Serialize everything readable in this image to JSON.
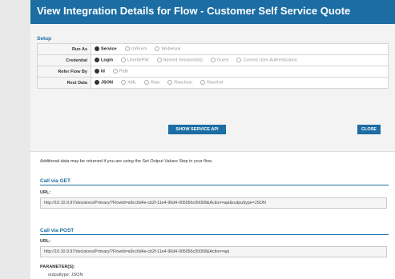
{
  "dialog": {
    "title": "View Integration Details for Flow - Customer Self Service Quote"
  },
  "setup": {
    "section_label": "Setup",
    "rows": [
      {
        "label": "Run As",
        "options": [
          {
            "text": "Service",
            "selected": true
          },
          {
            "text": "UI/Form",
            "selected": false
          },
          {
            "text": "WebHook",
            "selected": false
          }
        ]
      },
      {
        "label": "Credential",
        "options": [
          {
            "text": "Login",
            "selected": true
          },
          {
            "text": "UserId/PW",
            "selected": false
          },
          {
            "text": "Named Session(list)",
            "selected": false
          },
          {
            "text": "Guest",
            "selected": false
          },
          {
            "text": "Current User Authentication",
            "selected": false
          }
        ]
      },
      {
        "label": "Refer Flow By",
        "options": [
          {
            "text": "Id",
            "selected": true
          },
          {
            "text": "Path",
            "selected": false
          }
        ]
      },
      {
        "label": "Rest Data",
        "options": [
          {
            "text": "JSON",
            "selected": true
          },
          {
            "text": "XML",
            "selected": false
          },
          {
            "text": "Raw",
            "selected": false
          },
          {
            "text": "RawJson",
            "selected": false
          },
          {
            "text": "RawXml",
            "selected": false
          }
        ]
      }
    ]
  },
  "buttons": {
    "show_api": "SHOW SERVICE API",
    "close": "CLOSE"
  },
  "note": "Additional data may be returned if you are using the Set Output Values Step in your flow.",
  "get": {
    "heading": "Call via GET",
    "url_label": "URL:",
    "url": "http://10.10.9.97/decisions/Primary/?FlowId=a9cc6d4e-cb2f-11e4-90d4-005056c00008&Action=api&outputtype=JSON"
  },
  "post": {
    "heading": "Call via POST",
    "url_label": "URL:",
    "url": "http://10.10.9.97/decisions/Primary/?FlowId=a9cc6d4e-cb2f-11e4-90d4-005056c00008&Action=api",
    "params_label": "PARAMETER(S):",
    "params": [
      "outputtype: JSON"
    ]
  }
}
